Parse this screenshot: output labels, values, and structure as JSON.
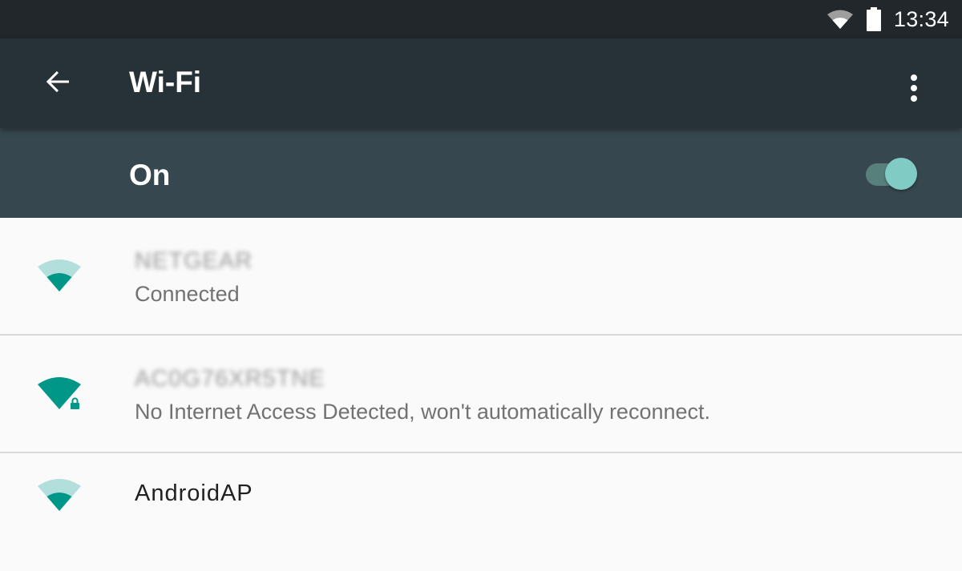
{
  "status_bar": {
    "time": "13:34",
    "icons": [
      "wifi-signal-icon",
      "battery-icon"
    ]
  },
  "app_bar": {
    "title": "Wi-Fi",
    "back_icon": "arrow-back-icon",
    "overflow_icon": "more-vert-icon"
  },
  "master_switch": {
    "label": "On",
    "checked": true
  },
  "networks": [
    {
      "ssid": "NETGEAR",
      "summary": "Connected",
      "signal_icon": "wifi-signal-2-bars-icon",
      "secured": false
    },
    {
      "ssid": "AC0G76XR5TNE",
      "summary": "No Internet Access Detected, won't automatically reconnect.",
      "signal_icon": "wifi-signal-full-lock-icon",
      "secured": true
    },
    {
      "ssid": "AndroidAP",
      "summary": "",
      "signal_icon": "wifi-signal-2-bars-icon",
      "secured": false
    }
  ],
  "colors": {
    "status_bar_bg": "#21272b",
    "app_bar_bg": "#263238",
    "switch_bar_bg": "#37474f",
    "accent": "#009688",
    "accent_light": "#80cbc4"
  }
}
